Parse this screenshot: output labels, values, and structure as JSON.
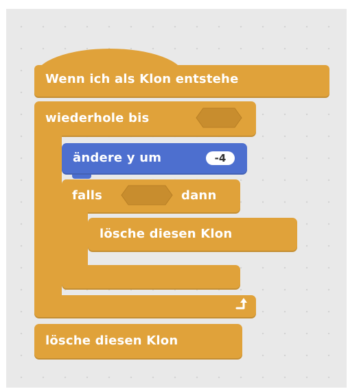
{
  "hat_block": {
    "label": "Wenn ich als Klon entstehe"
  },
  "repeat_until_block": {
    "label": "wiederhole bis"
  },
  "change_y_block": {
    "label": "ändere y um",
    "value": "-4"
  },
  "if_block": {
    "label_if": "falls",
    "label_then": "dann"
  },
  "delete_clone_inner": {
    "label": "lösche diesen Klon"
  },
  "delete_clone_final": {
    "label": "lösche diesen Klon"
  },
  "colors": {
    "control": "#e0a23a",
    "motion": "#4d6fcf",
    "canvas": "#e9e9e9"
  },
  "icons": {
    "loop": "loop-arrow-icon"
  }
}
